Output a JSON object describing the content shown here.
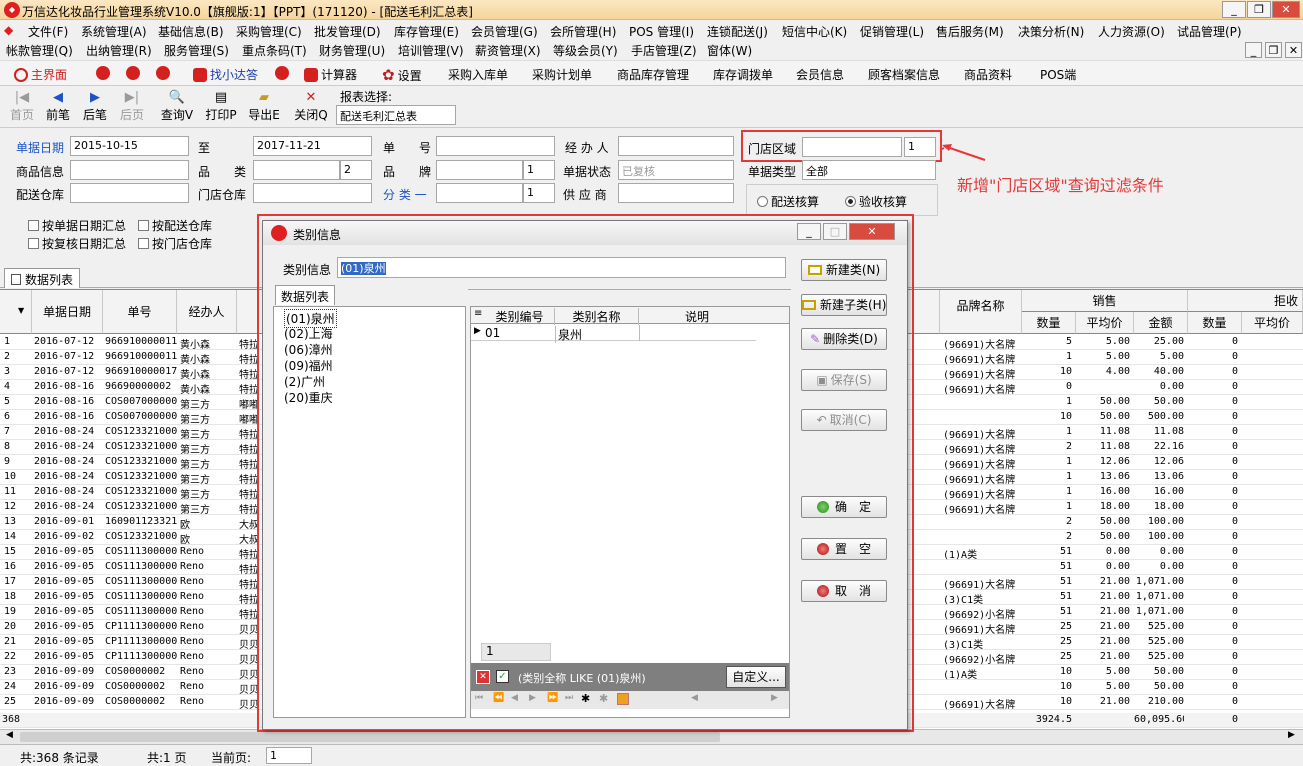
{
  "app": {
    "title": "万信达化妆品行业管理系统V10.0【旗舰版:1】【PPT】(171120) - [配送毛利汇总表]"
  },
  "menu1": [
    "文件(F)",
    "系统管理(A)",
    "基础信息(B)",
    "采购管理(C)",
    "批发管理(D)",
    "库存管理(E)",
    "会员管理(G)",
    "会所管理(H)",
    "POS 管理(I)",
    "连锁配送(J)",
    "短信中心(K)",
    "促销管理(L)",
    "售后服务(M)",
    "决策分析(N)",
    "人力资源(O)",
    "试品管理(P)"
  ],
  "menu2": [
    "帐款管理(Q)",
    "出纳管理(R)",
    "服务管理(S)",
    "重点条码(T)",
    "财务管理(U)",
    "培训管理(V)",
    "薪资管理(X)",
    "等级会员(Y)",
    "手店管理(Z)",
    "窗体(W)"
  ],
  "toolbar": {
    "main": "主界面",
    "find": "找小达答",
    "calc": "计算器",
    "settings": "设置",
    "links": [
      "采购入库单",
      "采购计划单",
      "商品库存管理",
      "库存调拨单",
      "会员信息",
      "顾客档案信息",
      "商品资料",
      "POS端"
    ]
  },
  "nav": {
    "first": "首页",
    "prev": "前笔",
    "next": "后笔",
    "last": "后页",
    "query": "查询V",
    "print": "打印P",
    "export": "导出E",
    "close": "关闭Q",
    "report_label": "报表选择:",
    "report_value": "配送毛利汇总表"
  },
  "filters": {
    "date_label": "单据日期",
    "date_from": "2015-10-15",
    "to_label": "至",
    "date_to": "2017-11-21",
    "docno_label": "单　　号",
    "handler_label": "经 办 人",
    "goods_label": "商品信息",
    "category_label": "品　　类",
    "category_num": "2",
    "brand_label": "品　　牌",
    "brand_num": "1",
    "status_label": "单据状态",
    "status_placeholder": "已复核",
    "dist_wh_label": "配送仓库",
    "store_wh_label": "门店仓库",
    "class_label": "分 类 一",
    "class_num": "1",
    "supplier_label": "供 应 商",
    "region_label": "门店区域",
    "region_num": "1",
    "doctype_label": "单据类型",
    "doctype_value": "全部",
    "radio1": "配送核算",
    "radio2": "验收核算",
    "checks": [
      "按单据日期汇总",
      "按配送仓库",
      "按复核日期汇总",
      "按门店仓库"
    ]
  },
  "annotation": "新增\"门店区域\"查询过滤条件",
  "datatab": "数据列表",
  "grid": {
    "headers": [
      "单据日期",
      "单号",
      "经办人",
      "品牌名称",
      "销售",
      "数量",
      "平均价",
      "金额",
      "数量",
      "平均价",
      "拒收"
    ],
    "rows": [
      [
        "1",
        "2016-07-12",
        "966910000011",
        "黄小森",
        "特拉",
        "(96691)大名牌",
        "5",
        "5.00",
        "25.00",
        "0"
      ],
      [
        "2",
        "2016-07-12",
        "966910000011",
        "黄小森",
        "特拉",
        "(96691)大名牌",
        "1",
        "5.00",
        "5.00",
        "0"
      ],
      [
        "3",
        "2016-07-12",
        "966910000017",
        "黄小森",
        "特拉",
        "(96691)大名牌",
        "10",
        "4.00",
        "40.00",
        "0"
      ],
      [
        "4",
        "2016-08-16",
        "96690000002",
        "黄小森",
        "特拉",
        "(96691)大名牌",
        "0",
        "",
        "0.00",
        "0"
      ],
      [
        "5",
        "2016-08-16",
        "COS007000000",
        "第三方",
        "嘟嘟",
        "",
        "1",
        "50.00",
        "50.00",
        "0"
      ],
      [
        "6",
        "2016-08-16",
        "COS007000000",
        "第三方",
        "嘟嘟",
        "",
        "10",
        "50.00",
        "500.00",
        "0"
      ],
      [
        "7",
        "2016-08-24",
        "COS123321000",
        "第三方",
        "特拉",
        "(96691)大名牌",
        "1",
        "11.08",
        "11.08",
        "0"
      ],
      [
        "8",
        "2016-08-24",
        "COS123321000",
        "第三方",
        "特拉",
        "(96691)大名牌",
        "2",
        "11.08",
        "22.16",
        "0"
      ],
      [
        "9",
        "2016-08-24",
        "COS123321000",
        "第三方",
        "特拉",
        "(96691)大名牌",
        "1",
        "12.06",
        "12.06",
        "0"
      ],
      [
        "10",
        "2016-08-24",
        "COS123321000",
        "第三方",
        "特拉",
        "(96691)大名牌",
        "1",
        "13.06",
        "13.06",
        "0"
      ],
      [
        "11",
        "2016-08-24",
        "COS123321000",
        "第三方",
        "特拉",
        "(96691)大名牌",
        "1",
        "16.00",
        "16.00",
        "0"
      ],
      [
        "12",
        "2016-08-24",
        "COS123321000",
        "第三方",
        "特拉",
        "(96691)大名牌",
        "1",
        "18.00",
        "18.00",
        "0"
      ],
      [
        "13",
        "2016-09-01",
        "160901123321",
        "欧",
        "大叔",
        "",
        "2",
        "50.00",
        "100.00",
        "0"
      ],
      [
        "14",
        "2016-09-02",
        "COS123321000",
        "欧",
        "大叔",
        "",
        "2",
        "50.00",
        "100.00",
        "0"
      ],
      [
        "15",
        "2016-09-05",
        "COS111300000",
        "Reno",
        "特拉",
        "(1)A类",
        "51",
        "0.00",
        "0.00",
        "0"
      ],
      [
        "16",
        "2016-09-05",
        "COS111300000",
        "Reno",
        "特拉",
        "",
        "51",
        "0.00",
        "0.00",
        "0"
      ],
      [
        "17",
        "2016-09-05",
        "COS111300000",
        "Reno",
        "特拉",
        "(96691)大名牌",
        "51",
        "21.00",
        "1,071.00",
        "0"
      ],
      [
        "18",
        "2016-09-05",
        "COS111300000",
        "Reno",
        "特拉",
        "(3)C1类",
        "51",
        "21.00",
        "1,071.00",
        "0"
      ],
      [
        "19",
        "2016-09-05",
        "COS111300000",
        "Reno",
        "特拉",
        "(96692)小名牌",
        "51",
        "21.00",
        "1,071.00",
        "0"
      ],
      [
        "20",
        "2016-09-05",
        "CP1111300000",
        "Reno",
        "贝贝",
        "(96691)大名牌",
        "25",
        "21.00",
        "525.00",
        "0"
      ],
      [
        "21",
        "2016-09-05",
        "CP1111300000",
        "Reno",
        "贝贝",
        "(3)C1类",
        "25",
        "21.00",
        "525.00",
        "0"
      ],
      [
        "22",
        "2016-09-05",
        "CP1111300000",
        "Reno",
        "贝贝",
        "(96692)小名牌",
        "25",
        "21.00",
        "525.00",
        "0"
      ],
      [
        "23",
        "2016-09-09",
        "COS0000002",
        "Reno",
        "贝贝",
        "(1)A类",
        "10",
        "5.00",
        "50.00",
        "0"
      ],
      [
        "24",
        "2016-09-09",
        "COS0000002",
        "Reno",
        "贝贝",
        "",
        "10",
        "5.00",
        "50.00",
        "0"
      ],
      [
        "25",
        "2016-09-09",
        "COS0000002",
        "Reno",
        "贝贝",
        "(96691)大名牌",
        "10",
        "21.00",
        "210.00",
        "0"
      ]
    ],
    "footer": {
      "count": "368",
      "qty": "3924.5",
      "amount": "60,095.60",
      "rej": "0"
    }
  },
  "status": {
    "records": "共:368 条记录",
    "pages": "共:1 页",
    "cur_label": "当前页:",
    "cur_value": "1"
  },
  "dialog": {
    "title": "类别信息",
    "info_label": "类别信息",
    "info_value": "(01)泉州",
    "tab": "数据列表",
    "tree": [
      "(01)泉州",
      "(02)上海",
      "(06)漳州",
      "(09)福州",
      "(2)广州",
      "(20)重庆"
    ],
    "cols": [
      "类别编号",
      "类别名称",
      "说明"
    ],
    "row": [
      "01",
      "泉州",
      ""
    ],
    "pager": "1",
    "filter_text": "(类别全称 LIKE (01)泉州)",
    "customize": "自定义...",
    "btns": {
      "new": "新建类(N)",
      "newsub": "新建子类(H)",
      "del": "删除类(D)",
      "save": "保存(S)",
      "cancel": "取消(C)",
      "ok": "确　定",
      "clear": "置　空",
      "abort": "取　消"
    }
  }
}
